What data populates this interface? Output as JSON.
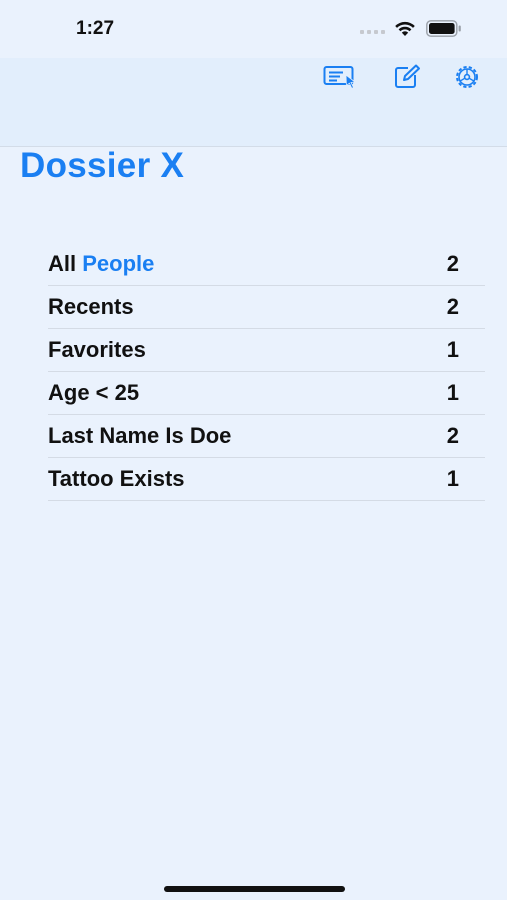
{
  "status_bar": {
    "time": "1:27"
  },
  "toolbar": {
    "buttons": [
      {
        "icon": "select-cursor-icon"
      },
      {
        "icon": "compose-icon"
      },
      {
        "icon": "gear-icon"
      }
    ]
  },
  "header": {
    "title": "Dossier X"
  },
  "list": {
    "items": [
      {
        "label": "All ",
        "label_accent": "People",
        "count": "2"
      },
      {
        "label": "Recents",
        "count": "2"
      },
      {
        "label": "Favorites",
        "count": "1"
      },
      {
        "label": "Age < 25",
        "count": "1"
      },
      {
        "label": "Last Name Is Doe",
        "count": "2"
      },
      {
        "label": "Tattoo Exists",
        "count": "1"
      }
    ]
  },
  "colors": {
    "accent": "#1a7ff2",
    "background": "#eaf2fd",
    "nav_background": "#e2eefc"
  }
}
